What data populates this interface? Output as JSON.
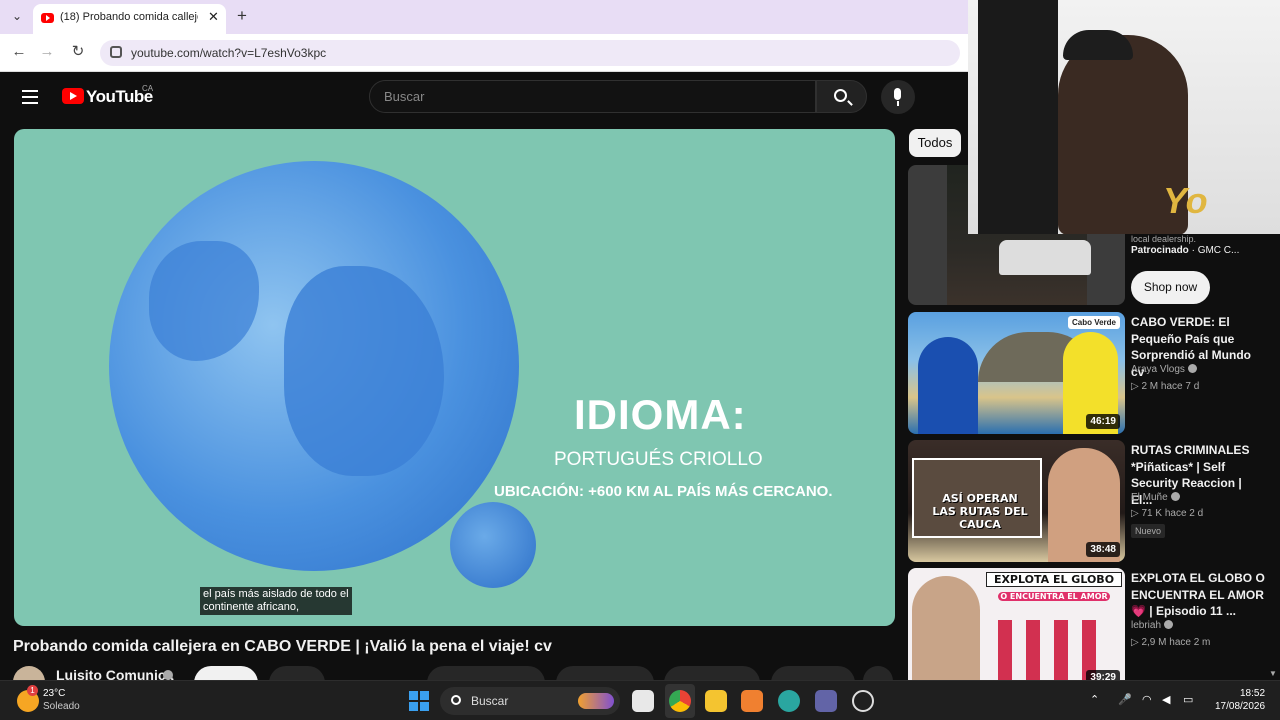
{
  "browser": {
    "tab_title": "(18) Probando comida callejera",
    "url": "youtube.com/watch?v=L7eshVo3kpc"
  },
  "youtube": {
    "logo_text": "YouTube",
    "region": "CA",
    "search_placeholder": "Buscar"
  },
  "video": {
    "overlay_title": "IDIOMA:",
    "overlay_subtitle": "PORTUGUÉS CRIOLLO",
    "overlay_location": "UBICACIÓN: +600 KM AL PAÍS MÁS CERCANO.",
    "caption": "el país más aislado de todo el continente africano,",
    "title": "Probando comida callejera en CABO VERDE | ¡Valió la pena el viaje! cv",
    "channel": "Luisito Comunica"
  },
  "sidebar": {
    "filter_chip": "Todos",
    "ad": {
      "meta": "local dealership.",
      "sponsored_label": "Patrocinado",
      "advertiser": "GMC C...",
      "cta": "Shop now"
    },
    "recommendations": [
      {
        "title": "CABO VERDE: El Pequeño País que Sorprendió al Mundo cv",
        "channel": "Araya Vlogs",
        "stats": "2 M  hace 7 d",
        "duration": "46:19",
        "tag": "Cabo Verde",
        "badge": ""
      },
      {
        "title": "RUTAS CRIMINALES *Piñaticas* | Self Security Reaccion | El...",
        "channel": "El Muñe",
        "stats": "71 K  hace 2 d",
        "duration": "38:48",
        "thumb_text": "ASÍ OPERAN LAS RUTAS DEL CAUCA",
        "badge": "Nuevo"
      },
      {
        "title": "EXPLOTA EL GLOBO O ENCUENTRA EL AMOR 💗 | Episodio 11 ...",
        "channel": "lebriah",
        "stats": "2,9 M  hace 2 m",
        "duration": "39:29",
        "thumb_text": "EXPLOTA EL GLOBO",
        "thumb_text2": "O ENCUENTRA EL AMOR",
        "badge": ""
      }
    ]
  },
  "webcam": {
    "overlay_text": "Yo"
  },
  "taskbar": {
    "weather_temp": "23°C",
    "weather_cond": "Soleado",
    "weather_badge": "1",
    "search_placeholder": "Buscar",
    "time": "18:52",
    "date": "17/08/2026"
  },
  "colors": {
    "youtube_red": "#ff0000",
    "background": "#0f0f0f",
    "player_bg": "#7fc6b1",
    "globe_blue": "#4a91df"
  }
}
